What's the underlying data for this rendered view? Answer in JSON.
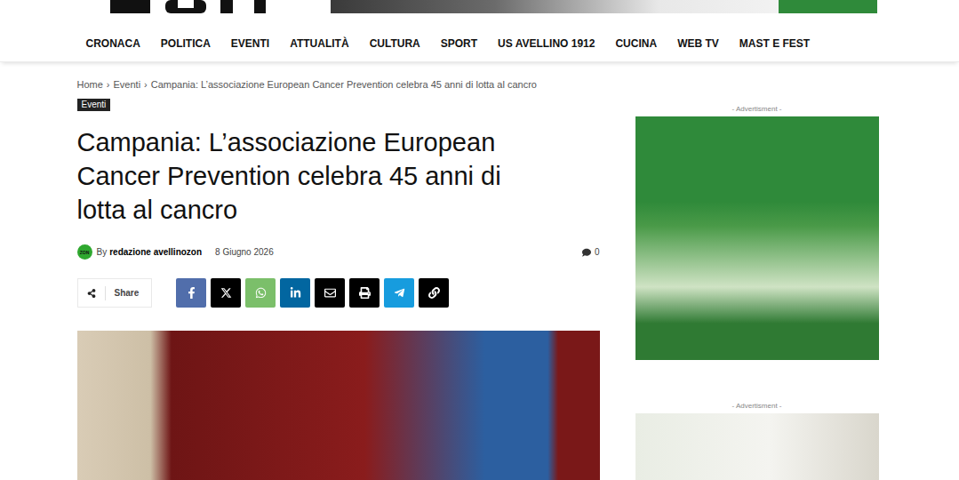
{
  "nav": {
    "items": [
      {
        "label": "CRONACA",
        "selected": false
      },
      {
        "label": "POLITICA",
        "selected": false
      },
      {
        "label": "EVENTI",
        "selected": false
      },
      {
        "label": "ATTUALITÀ",
        "selected": false
      },
      {
        "label": "CULTURA",
        "selected": false
      },
      {
        "label": "SPORT",
        "selected": false
      },
      {
        "label": "US AVELLINO 1912",
        "selected": false
      },
      {
        "label": "CUCINA",
        "selected": false
      },
      {
        "label": "WEB TV",
        "selected": false
      },
      {
        "label": "MAST E FEST",
        "selected": false
      }
    ]
  },
  "breadcrumb": {
    "separator": "›",
    "items": [
      "Home",
      "Eventi",
      "Campania: L’associazione European Cancer Prevention celebra 45 anni di lotta al cancro"
    ]
  },
  "article": {
    "tag": "Eventi",
    "title": "Campania: L’associazione European Cancer Prevention celebra 45 anni di lotta al cancro",
    "avatar": "ZON",
    "by": "By",
    "author": "redazione avellinozon",
    "date": "8 Giugno 2026",
    "comments": "0"
  },
  "share": {
    "label": "Share",
    "buttons": [
      {
        "name": "facebook",
        "color": "#516eab"
      },
      {
        "name": "x",
        "color": "#000000"
      },
      {
        "name": "whatsapp",
        "color": "#7bbf6a"
      },
      {
        "name": "linkedin",
        "color": "#0266a0"
      },
      {
        "name": "email",
        "color": "#000000"
      },
      {
        "name": "print",
        "color": "#000000"
      },
      {
        "name": "telegram",
        "color": "#179cde"
      },
      {
        "name": "copy-link",
        "color": "#000000"
      }
    ]
  },
  "sidebar": {
    "ads": [
      {
        "label": "- Advertisment -"
      },
      {
        "label": "- Advertisment -"
      }
    ]
  }
}
